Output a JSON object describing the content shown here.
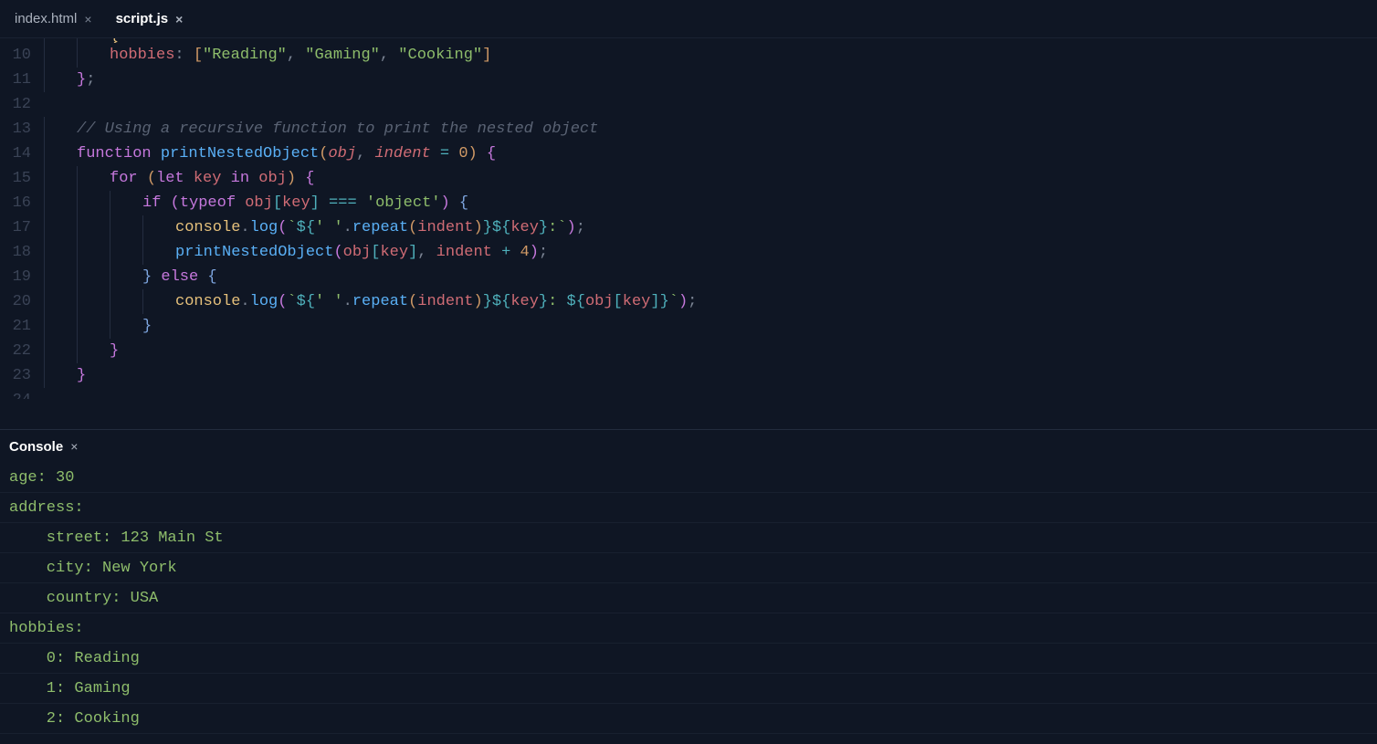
{
  "tabs": [
    {
      "label": "index.html",
      "active": false
    },
    {
      "label": "script.js",
      "active": true
    }
  ],
  "gutter_start": 10,
  "code_lines": {
    "l9_partial": "    },",
    "l10": "    hobbies: [\"Reading\", \"Gaming\", \"Cooking\"]",
    "l11": "};",
    "l12": "",
    "l13_comment": "// Using a recursive function to print the nested object",
    "l14": "function printNestedObject(obj, indent = 0) {",
    "l15": "    for (let key in obj) {",
    "l16": "        if (typeof obj[key] === 'object') {",
    "l17": "            console.log(`${' '.repeat(indent)}${key}:`);",
    "l18": "            printNestedObject(obj[key], indent + 4);",
    "l19": "        } else {",
    "l20": "            console.log(`${' '.repeat(indent)}${key}: ${obj[key]}`);",
    "l21": "        }",
    "l22": "    }",
    "l23": "}",
    "l24": ""
  },
  "tokens": {
    "hobbies": "hobbies",
    "reading": "\"Reading\"",
    "gaming": "\"Gaming\"",
    "cooking": "\"Cooking\"",
    "comment": "// Using a recursive function to print the nested object",
    "function": "function",
    "printNestedObject": "printNestedObject",
    "obj": "obj",
    "indent": "indent",
    "eq": " = ",
    "zero": "0",
    "for": "for",
    "let": "let",
    "key": "key",
    "in": "in",
    "if": "if",
    "typeof": "typeof",
    "tripleeq": " === ",
    "objectstr": "'object'",
    "console": "console",
    "log": "log",
    "repeat": "repeat",
    "spacechar": "' '",
    "four": "4",
    "plus": " + ",
    "else": "else",
    "colon": ":",
    "semicolon": ";",
    "comma": ", ",
    "dot": ".",
    "lparen": "(",
    "rparen": ")",
    "lbrace": "{",
    "rbrace": "}",
    "lbracket": "[",
    "rbracket": "]",
    "backtick": "`",
    "dollar_open": "${",
    "tmpl_close": "}",
    "tmpl_colon_end": ":`",
    "tmpl_colon_sp": ": "
  },
  "console": {
    "title": "Console",
    "lines": [
      "age: 30",
      "address:",
      "    street: 123 Main St",
      "    city: New York",
      "    country: USA",
      "hobbies:",
      "    0: Reading",
      "    1: Gaming",
      "    2: Cooking"
    ]
  }
}
